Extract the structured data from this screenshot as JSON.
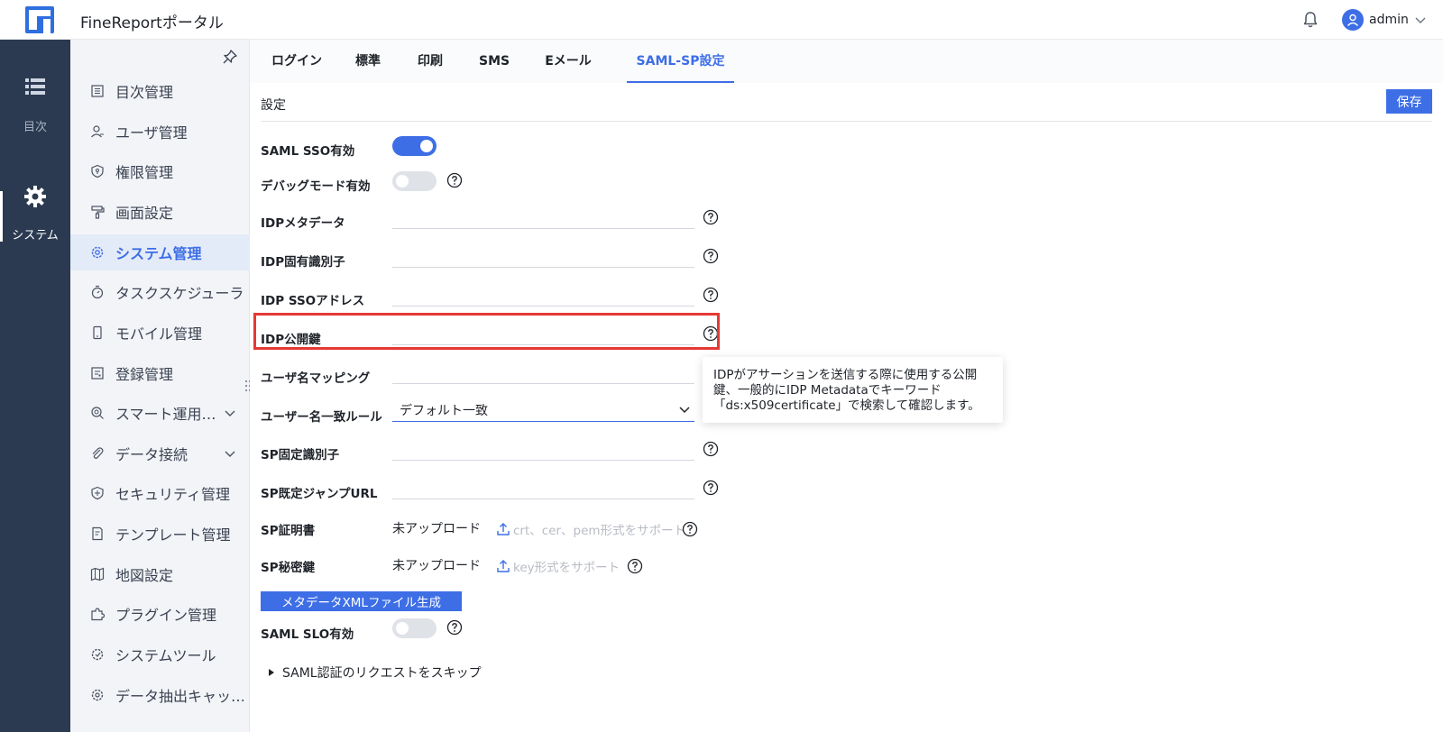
{
  "header": {
    "app_title": "FineReportポータル",
    "user_name": "admin",
    "brand_color": "#3d6ee6"
  },
  "rail": {
    "items": [
      {
        "label": "目次",
        "icon": "list-icon",
        "active": false
      },
      {
        "label": "システム",
        "icon": "gear-icon",
        "active": true
      }
    ]
  },
  "sidebar": {
    "items": [
      {
        "label": "目次管理",
        "icon": "directory-icon"
      },
      {
        "label": "ユーザ管理",
        "icon": "user-icon"
      },
      {
        "label": "権限管理",
        "icon": "shield-icon"
      },
      {
        "label": "画面設定",
        "icon": "paint-roller-icon"
      },
      {
        "label": "システム管理",
        "icon": "gear-icon",
        "active": true
      },
      {
        "label": "タスクスケジューラ",
        "icon": "stopwatch-icon"
      },
      {
        "label": "モバイル管理",
        "icon": "mobile-icon"
      },
      {
        "label": "登録管理",
        "icon": "register-icon"
      },
      {
        "label": "スマート運用…",
        "icon": "smart-ops-icon",
        "expandable": true
      },
      {
        "label": "データ接続",
        "icon": "paperclip-icon",
        "expandable": true
      },
      {
        "label": "セキュリティ管理",
        "icon": "security-icon"
      },
      {
        "label": "テンプレート管理",
        "icon": "template-icon"
      },
      {
        "label": "地図設定",
        "icon": "map-icon"
      },
      {
        "label": "プラグイン管理",
        "icon": "puzzle-icon"
      },
      {
        "label": "システムツール",
        "icon": "tool-gear-icon"
      },
      {
        "label": "データ抽出キャッ…",
        "icon": "extract-gear-icon"
      }
    ]
  },
  "tabs": [
    {
      "label": "ログイン"
    },
    {
      "label": "標準"
    },
    {
      "label": "印刷"
    },
    {
      "label": "SMS"
    },
    {
      "label": "Eメール"
    },
    {
      "label": "SAML-SP設定",
      "active": true
    }
  ],
  "settings": {
    "section_title": "設定",
    "save_label": "保存",
    "saml_sso_label": "SAML SSO有効",
    "saml_sso_enabled": true,
    "debug_label": "デバッグモード有効",
    "debug_enabled": false,
    "idp_metadata_label": "IDPメタデータ",
    "idp_metadata_value": "",
    "idp_entity_label": "IDP固有識別子",
    "idp_entity_value": "",
    "idp_sso_label": "IDP SSOアドレス",
    "idp_sso_value": "",
    "idp_pubkey_label": "IDP公開鍵",
    "idp_pubkey_value": "",
    "username_mapping_label": "ユーザ名マッピング",
    "username_mapping_value": "",
    "username_rule_label": "ユーザー名一致ルール",
    "username_rule_value": "デフォルト一致",
    "sp_entity_label": "SP固定識別子",
    "sp_entity_value": "",
    "sp_redirect_label": "SP既定ジャンプURL",
    "sp_redirect_value": "",
    "sp_cert_label": "SP証明書",
    "sp_cert_status": "未アップロード",
    "sp_cert_hint": "crt、cer、pem形式をサポート",
    "sp_key_label": "SP秘密鍵",
    "sp_key_status": "未アップロード",
    "sp_key_hint": "key形式をサポート",
    "generate_button": "メタデータXMLファイル生成",
    "saml_slo_label": "SAML SLO有効",
    "saml_slo_enabled": false,
    "skip_auth_label": "SAML認証のリクエストをスキップ"
  },
  "tooltip": {
    "line1": "IDPがアサーションを送信する際に使用する公開",
    "line2": "鍵、一般的にIDP Metadataでキーワード",
    "line3": "「ds:x509certificate」で検索して確認します。"
  }
}
